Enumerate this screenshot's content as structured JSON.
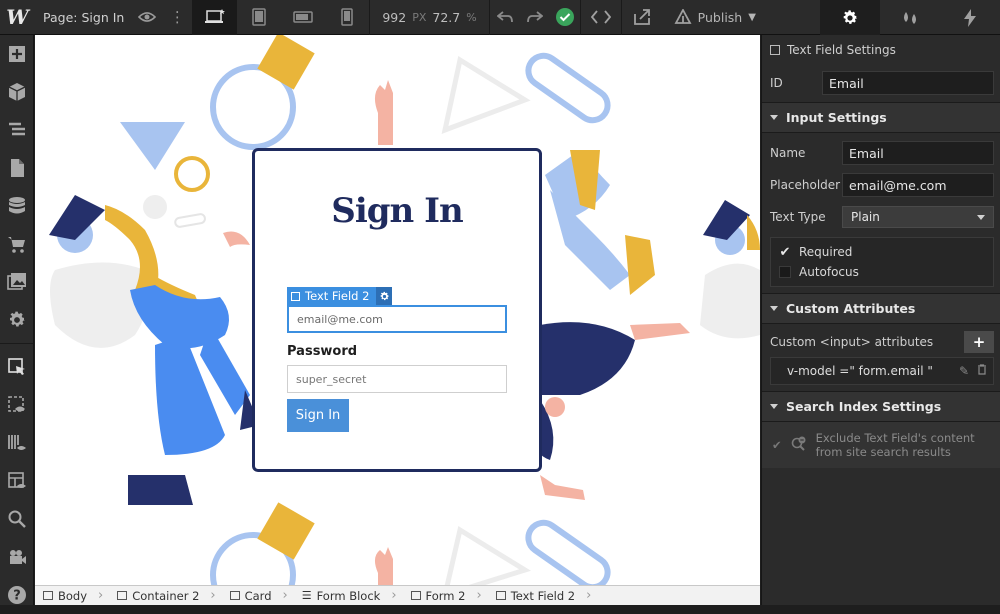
{
  "topbar": {
    "logo": "W",
    "page_label": "Page:",
    "page_name": "Sign In",
    "width_value": "992",
    "width_unit": "PX",
    "zoom_value": "72.7",
    "zoom_unit": "%",
    "publish_label": "Publish"
  },
  "canvas": {
    "card_title": "Sign In",
    "selection_label": "Text Field 2",
    "email_placeholder": "email@me.com",
    "password_label": "Password",
    "password_placeholder": "super_secret",
    "submit_label": "Sign In"
  },
  "breadcrumbs": [
    "Body",
    "Container 2",
    "Card",
    "Form Block",
    "Form 2",
    "Text Field 2"
  ],
  "panel": {
    "settings_title": "Text Field Settings",
    "id_label": "ID",
    "id_value": "Email",
    "input_settings_title": "Input Settings",
    "name_label": "Name",
    "name_value": "Email",
    "placeholder_label": "Placeholder",
    "placeholder_value": "email@me.com",
    "text_type_label": "Text Type",
    "text_type_value": "Plain",
    "required_label": "Required",
    "autofocus_label": "Autofocus",
    "custom_attrs_title": "Custom Attributes",
    "custom_attrs_label": "Custom <input> attributes",
    "attr_value": "v-model =\" form.email \"",
    "search_index_title": "Search Index Settings",
    "search_exclude_line1": "Exclude Text Field's content",
    "search_exclude_line2": "from site search results"
  },
  "colors": {
    "accent": "#3b8fe0",
    "card_border": "#1f2b5e",
    "publish_check": "#3aa55c",
    "yellow": "#e9b53a",
    "light_blue": "#a8c4f0",
    "blue": "#4a8cf0",
    "navy": "#25306b",
    "skin": "#f4b3a3"
  }
}
